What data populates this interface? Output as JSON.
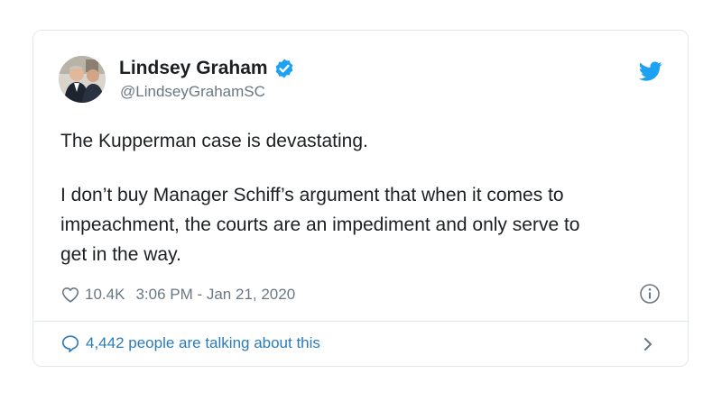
{
  "author": {
    "display_name": "Lindsey Graham",
    "handle": "@LindseyGrahamSC",
    "verified": true,
    "avatar_icon": "profile-photo"
  },
  "tweet": {
    "paragraphs": [
      [
        "The Kupperman case is devastating."
      ],
      [
        "I don’t buy Manager Schiff’s argument that when it comes to",
        "impeachment, the courts are an impediment and only serve to",
        "get in the way."
      ]
    ]
  },
  "meta": {
    "likes": "10.4K",
    "timestamp": "3:06 PM - Jan 21, 2020"
  },
  "footer": {
    "conversation_text": "4,442 people are talking about this"
  },
  "icons": {
    "brand": "twitter-bird-icon",
    "verified": "verified-badge-icon",
    "like": "heart-icon",
    "info": "info-icon",
    "conversation": "speech-bubble-icon",
    "more": "chevron-right-icon"
  },
  "colors": {
    "twitter_blue": "#1da1f2",
    "link_blue": "#2b7bb9",
    "text": "#1c2022",
    "muted": "#697882",
    "border": "#e1e8ed"
  }
}
